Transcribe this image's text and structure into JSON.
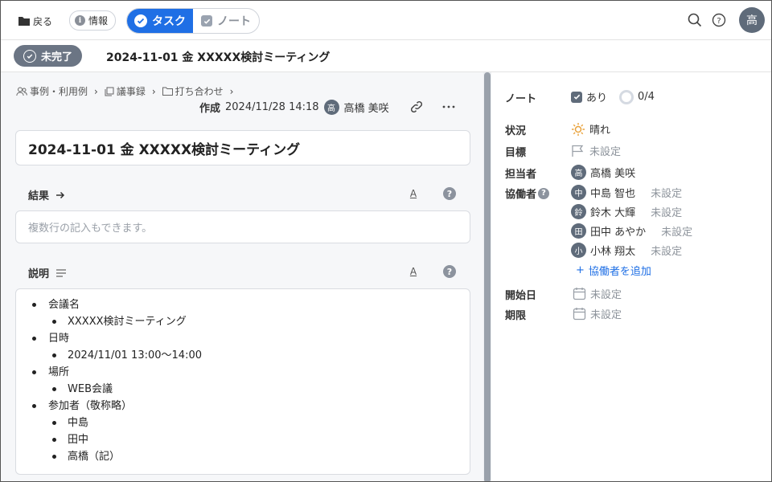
{
  "toolbar": {
    "back_label": "戻る",
    "info_label": "情報",
    "task_tab": "タスク",
    "note_tab": "ノート",
    "user_initial": "高"
  },
  "task": {
    "status": "未完了",
    "title": "2024-11-01 金 XXXXX検討ミーティング"
  },
  "breadcrumb": [
    "事例・利用例",
    "議事録",
    "打ち合わせ"
  ],
  "meta": {
    "created_label": "作成",
    "created_at": "2024/11/28 14:18",
    "author_initial": "高",
    "author_name": "高橋 美咲"
  },
  "result": {
    "heading": "結果",
    "placeholder": "複数行の記入もできます。"
  },
  "description": {
    "heading": "説明",
    "items": [
      {
        "text": "会議名",
        "children": [
          "XXXXX検討ミーティング"
        ]
      },
      {
        "text": "日時",
        "children": [
          "2024/11/01 13:00〜14:00"
        ]
      },
      {
        "text": "場所",
        "children": [
          "WEB会議"
        ]
      },
      {
        "text": "参加者（敬称略）",
        "children": [
          "中島",
          "田中",
          "高橋（記）"
        ]
      }
    ]
  },
  "properties": {
    "note_label": "ノート",
    "note_value": "あり",
    "note_progress": "0/4",
    "state_label": "状況",
    "state_value": "晴れ",
    "goal_label": "目標",
    "goal_value": "未設定",
    "assignee_label": "担当者",
    "assignee_initial": "高",
    "assignee_name": "高橋 美咲",
    "collab_label": "協働者",
    "collaborators": [
      {
        "initial": "中",
        "name": "中島 智也",
        "role": "未設定"
      },
      {
        "initial": "鈴",
        "name": "鈴木 大輝",
        "role": "未設定"
      },
      {
        "initial": "田",
        "name": "田中 あやか",
        "role": "未設定"
      },
      {
        "initial": "小",
        "name": "小林 翔太",
        "role": "未設定"
      }
    ],
    "add_collab": "協働者を追加",
    "start_label": "開始日",
    "start_value": "未設定",
    "due_label": "期限",
    "due_value": "未設定"
  },
  "icons": {
    "back": "folder-icon",
    "info": "info-icon",
    "search": "search-icon",
    "help": "help-icon",
    "link": "link-icon",
    "more": "more-icon",
    "weather": "sun-icon",
    "goal": "flag-icon",
    "date": "calendar-icon"
  },
  "colors": {
    "accent": "#1f6fe5",
    "status_pill": "#6b7584",
    "avatar": "#5f6b7a"
  }
}
